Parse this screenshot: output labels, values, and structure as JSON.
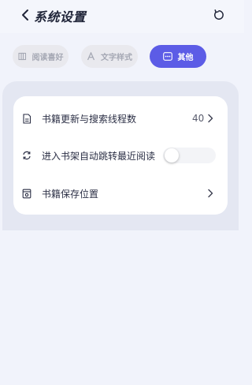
{
  "header": {
    "title": "系统设置",
    "back_icon": "chevron-left-icon",
    "reset_icon": "refresh-icon"
  },
  "tabs": [
    {
      "label": "阅读喜好",
      "icon": "book-icon",
      "active": false
    },
    {
      "label": "文字样式",
      "icon": "text-a-icon",
      "active": false
    },
    {
      "label": "其他",
      "icon": "more-icon",
      "active": true
    }
  ],
  "settings": {
    "rows": [
      {
        "label": "书籍更新与搜索线程数",
        "value": "40",
        "icon": "document-icon"
      },
      {
        "label": "进入书架自动跳转最近阅读",
        "toggle_on": false,
        "icon": "sync-icon"
      },
      {
        "label": "书籍保存位置",
        "icon": "folder-save-icon"
      }
    ]
  },
  "colors": {
    "accent": "#5c5ce6",
    "background": "#f1f3fb",
    "card": "#ffffff",
    "panel": "#e4e7f2"
  }
}
